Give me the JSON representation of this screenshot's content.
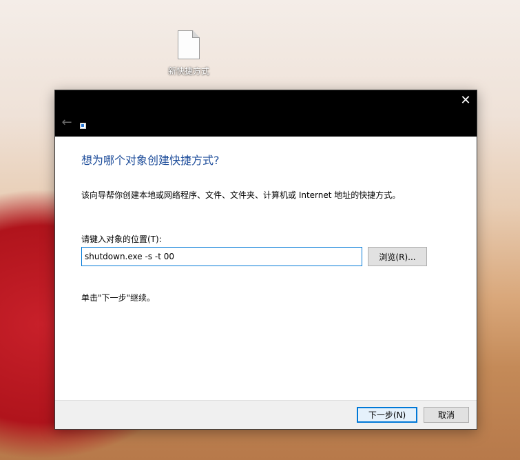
{
  "desktop": {
    "shortcut_label": "新快捷方式"
  },
  "dialog": {
    "close_glyph": "✕",
    "back_glyph": "←",
    "heading": "想为哪个对象创建快捷方式?",
    "description": "该向导帮你创建本地或网络程序、文件、文件夹、计算机或 Internet 地址的快捷方式。",
    "field_label": "请键入对象的位置(T):",
    "location_value": "shutdown.exe -s -t 00",
    "browse_label": "浏览(R)...",
    "hint": "单击\"下一步\"继续。",
    "next_label": "下一步(N)",
    "cancel_label": "取消",
    "accent_color": "#0078d7",
    "heading_color": "#1f4e9b"
  },
  "icons": [
    "file-icon",
    "close-icon",
    "back-arrow-icon",
    "shortcut-wizard-icon"
  ]
}
